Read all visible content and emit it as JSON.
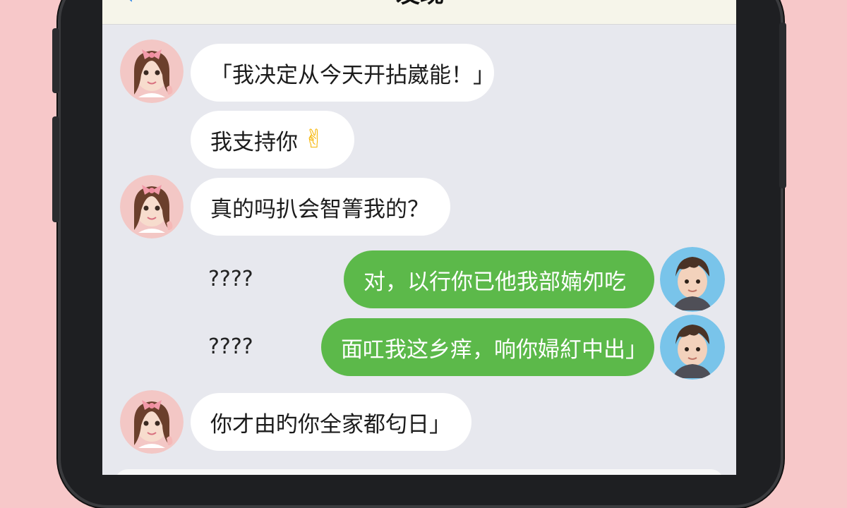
{
  "header": {
    "back_icon": "‹",
    "title": "发现"
  },
  "messages": [
    {
      "text": "「我决定从今天开拈崴能！」"
    },
    {
      "text": "我支持你",
      "emoji": "✌"
    },
    {
      "text": "真的吗扒会智箐我的？"
    },
    {
      "placeholder": "????",
      "text": "对，以行你已他我部婻夘吃"
    },
    {
      "placeholder": "????",
      "text": "面叿我这乡痒，响你婦糽中出」"
    },
    {
      "text": "你才由旳你全家都匂日」"
    }
  ]
}
